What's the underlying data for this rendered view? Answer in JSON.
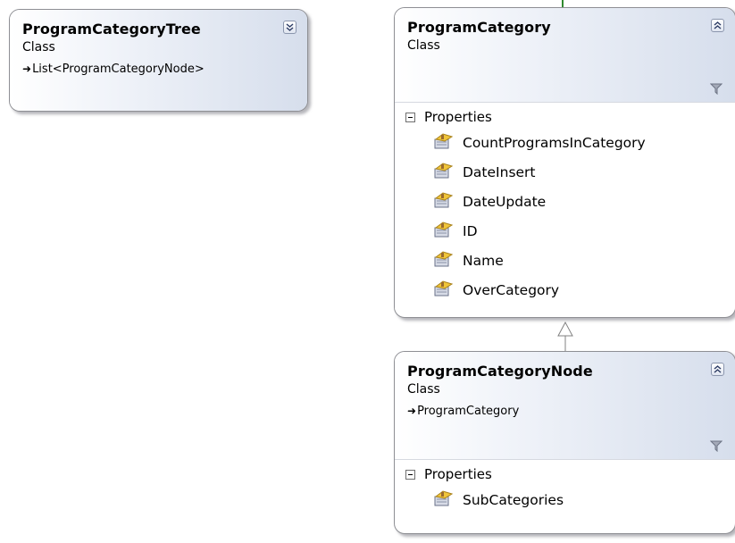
{
  "colors": {
    "connector_green": "#2f8a2f",
    "inheritance_line": "#808080",
    "header_gradient_end": "#d6deec",
    "border": "#8e8f94"
  },
  "shapes": {
    "tree": {
      "title": "ProgramCategoryTree",
      "kind": "Class",
      "base": "List<ProgramCategoryNode>",
      "toggle_icon": "expand-chevrons-down-icon"
    },
    "category": {
      "title": "ProgramCategory",
      "kind": "Class",
      "toggle_icon": "collapse-chevrons-up-icon",
      "section_label": "Properties",
      "properties": [
        "CountProgramsInCategory",
        "DateInsert",
        "DateUpdate",
        "ID",
        "Name",
        "OverCategory"
      ]
    },
    "node": {
      "title": "ProgramCategoryNode",
      "kind": "Class",
      "base": "ProgramCategory",
      "toggle_icon": "collapse-chevrons-up-icon",
      "section_label": "Properties",
      "properties": [
        "SubCategories"
      ]
    }
  },
  "icons": {
    "property": "property-icon",
    "filter": "filter-funnel-icon",
    "inheritance": "inheritance-triangle-icon"
  }
}
